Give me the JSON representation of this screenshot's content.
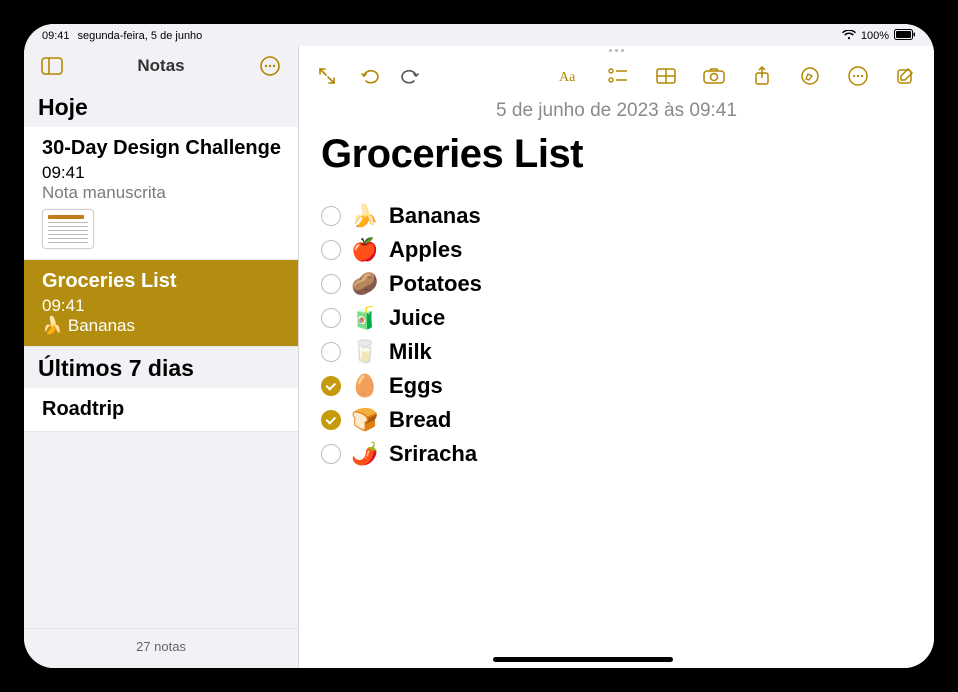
{
  "statusbar": {
    "time": "09:41",
    "date": "segunda-feira, 5 de junho",
    "battery": "100%"
  },
  "sidebar": {
    "title": "Notas",
    "footer": "27 notas",
    "sections": [
      {
        "header": "Hoje",
        "items": [
          {
            "title": "30-Day Design Challenge",
            "time": "09:41",
            "sub": "Nota manuscrita",
            "selected": false,
            "thumb": true
          },
          {
            "title": "Groceries List",
            "time": "09:41",
            "sub": "🍌 Bananas",
            "selected": true,
            "thumb": false
          }
        ]
      },
      {
        "header": "Últimos 7 dias",
        "items": [
          {
            "title": "Roadtrip",
            "time": "",
            "sub": "",
            "selected": false,
            "thumb": false
          }
        ]
      }
    ]
  },
  "note": {
    "date": "5 de junho de 2023 às 09:41",
    "title": "Groceries List",
    "items": [
      {
        "checked": false,
        "emoji": "🍌",
        "text": "Bananas"
      },
      {
        "checked": false,
        "emoji": "🍎",
        "text": "Apples"
      },
      {
        "checked": false,
        "emoji": "🥔",
        "text": "Potatoes"
      },
      {
        "checked": false,
        "emoji": "🧃",
        "text": "Juice"
      },
      {
        "checked": false,
        "emoji": "🥛",
        "text": "Milk"
      },
      {
        "checked": true,
        "emoji": "🥚",
        "text": "Eggs"
      },
      {
        "checked": true,
        "emoji": "🍞",
        "text": "Bread"
      },
      {
        "checked": false,
        "emoji": "🌶️",
        "text": "Sriracha"
      }
    ]
  }
}
